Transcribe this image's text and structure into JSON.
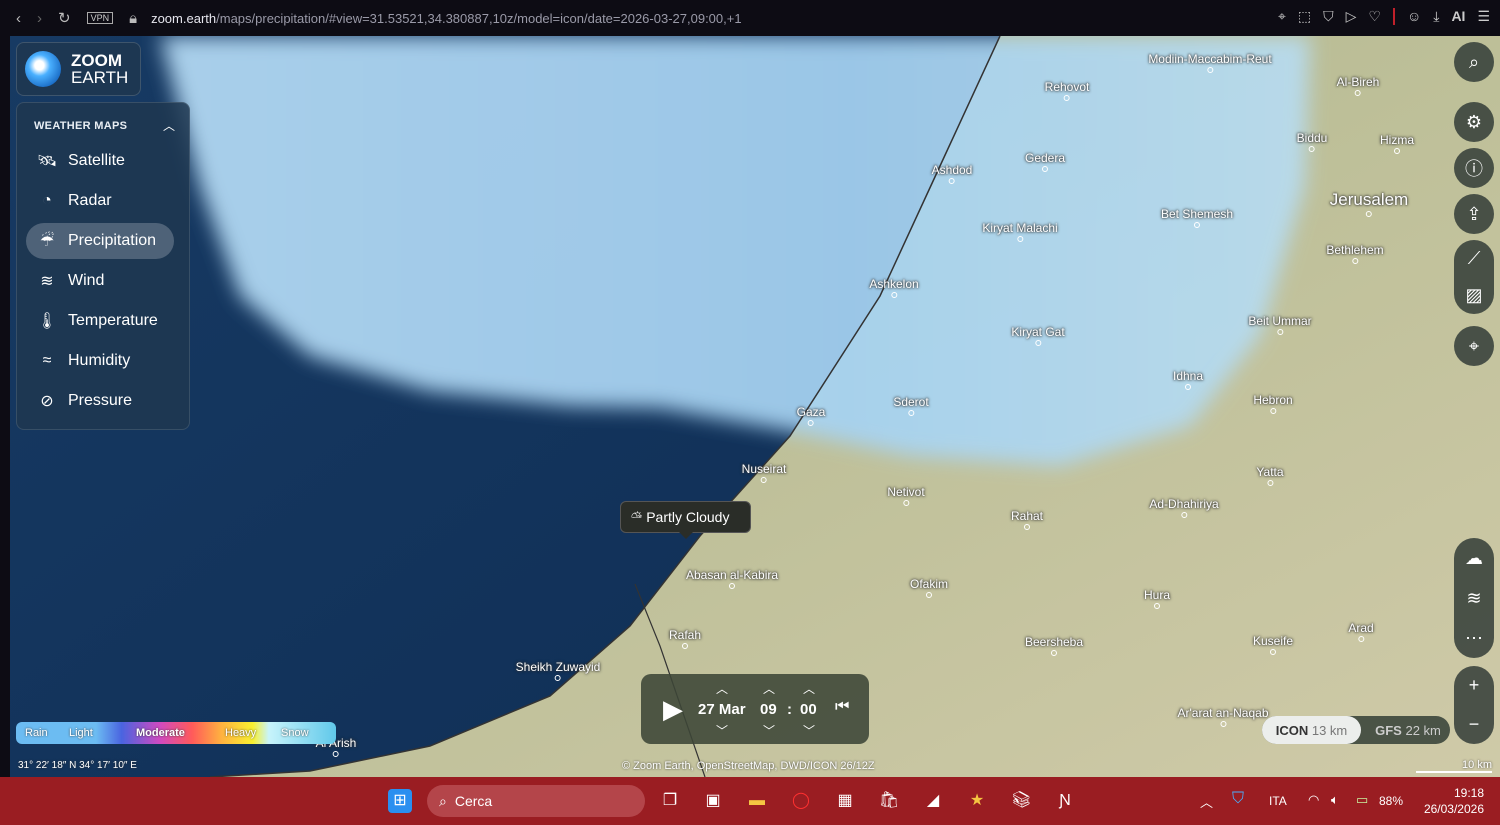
{
  "browser": {
    "url_host": "zoom.earth",
    "url_path": "/maps/precipitation/#view=31.53521,34.380887,10z/model=icon/date=2026-03-27,09:00,+1",
    "vpn_label": "VPN",
    "ai_label": "AI"
  },
  "logo": {
    "line1": "ZOOM",
    "line2": "EARTH"
  },
  "menu": {
    "header": "WEATHER MAPS",
    "items": [
      {
        "label": "Satellite",
        "icon": "satellite-icon"
      },
      {
        "label": "Radar",
        "icon": "radar-icon"
      },
      {
        "label": "Precipitation",
        "icon": "precipitation-icon",
        "active": true
      },
      {
        "label": "Wind",
        "icon": "wind-icon"
      },
      {
        "label": "Temperature",
        "icon": "thermometer-icon"
      },
      {
        "label": "Humidity",
        "icon": "humidity-icon"
      },
      {
        "label": "Pressure",
        "icon": "pressure-icon"
      }
    ]
  },
  "places": [
    "Rehovot",
    "Modiin-Maccabim-Reut",
    "Al-Bireh",
    "Ashdod",
    "Gedera",
    "Biddu",
    "Hizma",
    "Jerusalem",
    "Bet Shemesh",
    "Kiryat Malachi",
    "Bethlehem",
    "Ashkelon",
    "Beit Ummar",
    "Kiryat Gat",
    "Idhna",
    "Sderot",
    "Hebron",
    "Gaza",
    "Nuseirat",
    "Yatta",
    "Netivot",
    "Ad-Dhahiriya",
    "Rahat",
    "Abasan al-Kabira",
    "Ofakim",
    "Hura",
    "Rafah",
    "Kuseife",
    "Arad",
    "Beersheba",
    "Sheikh Zuwayid",
    "Ar'arat an-Naqab",
    "Al Arish"
  ],
  "tooltip": {
    "label": "Partly Cloudy",
    "icon": "partly-cloudy-icon"
  },
  "time": {
    "date": "27 Mar",
    "hour": "09",
    "sep": ":",
    "minute": "00"
  },
  "legend": {
    "rain": "Rain",
    "light": "Light",
    "moderate": "Moderate",
    "heavy": "Heavy",
    "snow": "Snow"
  },
  "coords": "31° 22′ 18″ N  34° 17′ 10″ E",
  "attribution": "© Zoom Earth, OpenStreetMap, DWD/ICON 26/12Z",
  "scale": "10 km",
  "models": [
    {
      "name": "ICON",
      "res": "13 km",
      "active": true
    },
    {
      "name": "GFS",
      "res": "22 km"
    }
  ],
  "taskbar": {
    "search": "Cerca",
    "lang": "ITA",
    "battery": "88%",
    "time": "19:18",
    "date": "26/03/2026"
  }
}
